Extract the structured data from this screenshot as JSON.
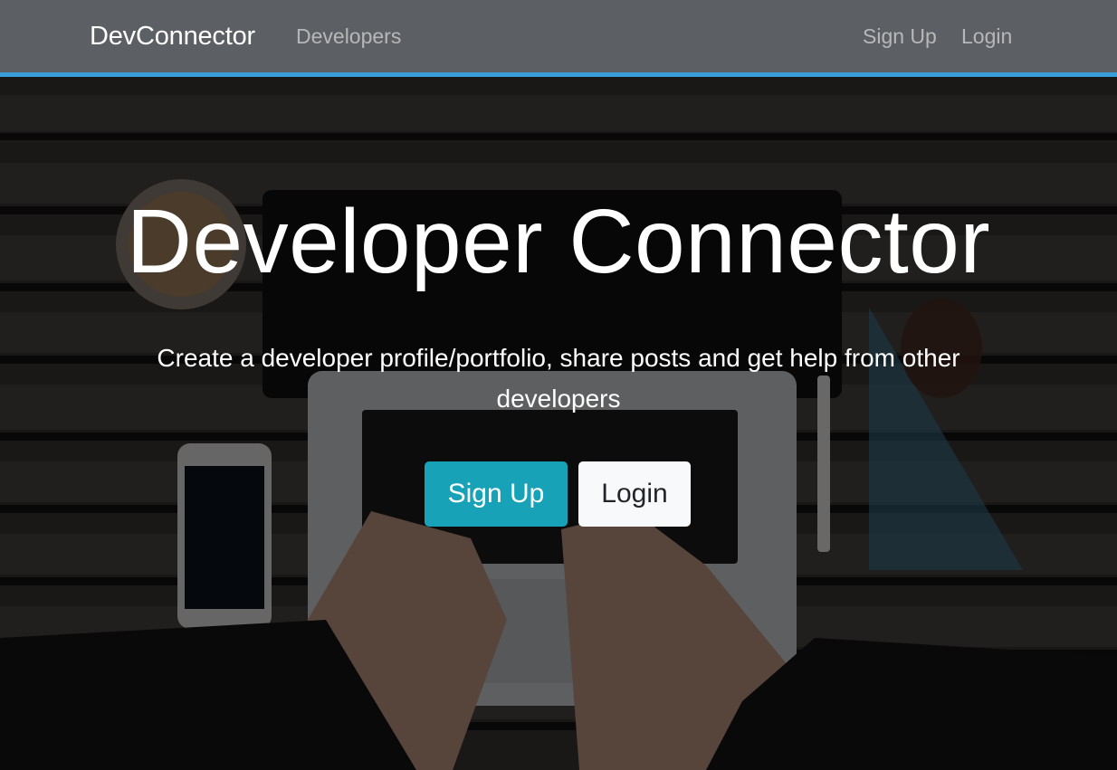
{
  "navbar": {
    "brand": "DevConnector",
    "links": {
      "developers": "Developers",
      "signup": "Sign Up",
      "login": "Login"
    },
    "accent_color": "#3a9fd8"
  },
  "landing": {
    "title": "Developer Connector",
    "lead": "Create a developer profile/portfolio, share posts and get help from other developers",
    "buttons": {
      "signup": "Sign Up",
      "login": "Login"
    },
    "colors": {
      "signup_bg": "#17a2b8",
      "login_bg": "#f8f9fa"
    }
  }
}
